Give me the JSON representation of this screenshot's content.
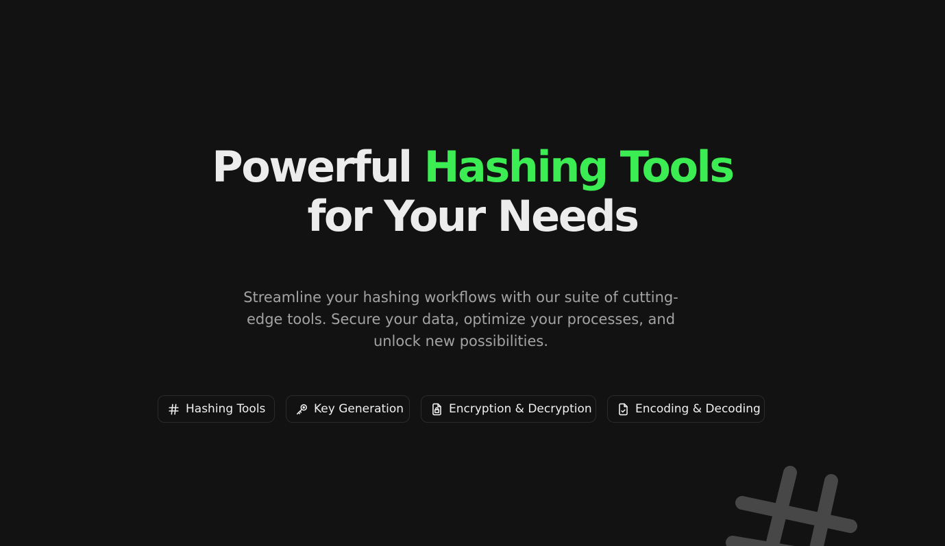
{
  "hero": {
    "headline_part1": "Powerful ",
    "headline_accent": "Hashing Tools",
    "headline_line2": "for Your Needs",
    "subtitle": "Streamline your hashing workflows with our suite of cutting-edge tools. Secure your data, optimize your processes, and unlock new possibilities."
  },
  "pills": [
    {
      "label": "Hashing Tools",
      "icon": "hash-icon"
    },
    {
      "label": "Key Generation",
      "icon": "key-icon"
    },
    {
      "label": "Encryption & Decryption",
      "icon": "file-lock-icon"
    },
    {
      "label": "Encoding & Decoding",
      "icon": "file-check-icon"
    }
  ],
  "colors": {
    "background": "#121212",
    "text": "#ececec",
    "accent": "#3cec53",
    "muted": "#a3a3a3",
    "pill_border": "#2b2b2b",
    "decoration": "#474747"
  },
  "decoration": {
    "icon": "hash-icon"
  }
}
